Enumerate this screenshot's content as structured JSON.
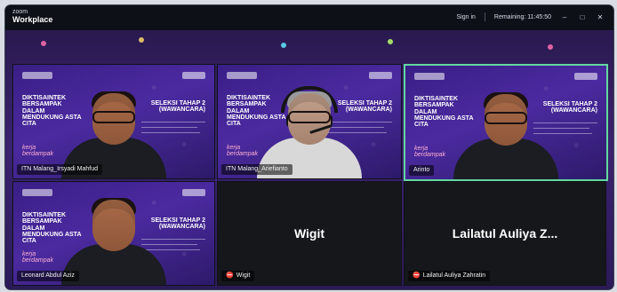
{
  "app": {
    "brand_small": "zoom",
    "brand_big": "Workplace"
  },
  "titlebar": {
    "sign_in": "Sign in",
    "remaining": "Remaining: 11:45:50",
    "minimize": "–",
    "maximize": "□",
    "close": "✕"
  },
  "tiles": [
    {
      "id": "t1",
      "name": "ITN Malang_Irsyadi Mahfud",
      "left_title": "DIKTISAINTEK BERSAMPAK DALAM MENDUKUNG ASTA CITA",
      "right_title": "SELEKSI TAHAP 2 (WAWANCARA)",
      "tagline": "kerja berdampak"
    },
    {
      "id": "t2",
      "name": "ITN Malang_Ariefianto",
      "left_title": "DIKTISAINTEK BERSAMPAK DALAM MENDUKUNG ASTA CITA",
      "right_title": "SELEKSI TAHAP 2 (WAWANCARA)",
      "tagline": "kerja berdampak"
    },
    {
      "id": "t3",
      "name": "Arinto",
      "left_title": "DIKTISAINTEK BERSAMPAK DALAM MENDUKUNG ASTA CITA",
      "right_title": "SELEKSI TAHAP 2 (WAWANCARA)",
      "tagline": "kerja berdampak"
    },
    {
      "id": "t4",
      "name": "Leonard Abdul Aziz",
      "left_title": "DIKTISAINTEK BERSAMPAK DALAM MENDUKUNG ASTA CITA",
      "right_title": "SELEKSI TAHAP 2 (WAWANCARA)",
      "tagline": "kerja berdampak"
    },
    {
      "id": "t5",
      "name": "Wigit",
      "big_name": "Wigit"
    },
    {
      "id": "t6",
      "name": "Lailatul Auliya Zahratin",
      "big_name": "Lailatul Auliya Z..."
    }
  ]
}
